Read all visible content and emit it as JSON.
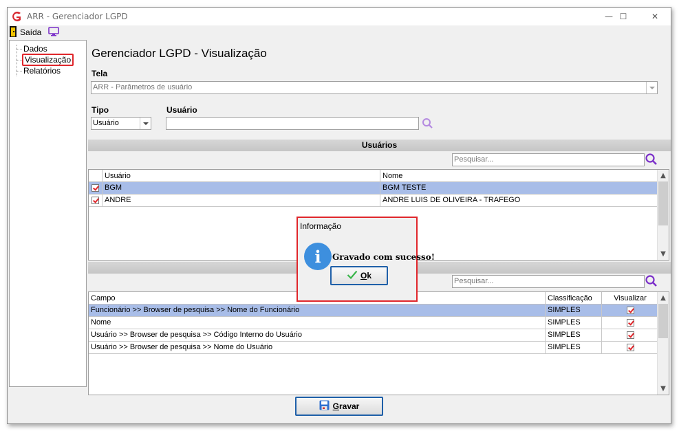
{
  "window": {
    "title": "ARR - Gerenciador LGPD",
    "minimize_glyph": "—",
    "maximize_glyph": "☐",
    "close_glyph": "✕"
  },
  "menubar": {
    "exit_label": "Saída"
  },
  "tree": {
    "items": [
      {
        "label": "Dados"
      },
      {
        "label": "Visualização"
      },
      {
        "label": "Relatórios"
      }
    ]
  },
  "page": {
    "title": "Gerenciador LGPD - Visualização",
    "screen_label": "Tela",
    "screen_value": "ARR - Parâmetros de usuário",
    "type_label": "Tipo",
    "type_value": "Usuário",
    "user_label": "Usuário",
    "user_value": ""
  },
  "users_section": {
    "title": "Usuários",
    "search_placeholder": "Pesquisar...",
    "columns": [
      "Usuário",
      "Nome"
    ],
    "rows": [
      {
        "checked": true,
        "user": "BGM",
        "name": "BGM TESTE"
      },
      {
        "checked": true,
        "user": "ANDRE",
        "name": "ANDRE LUIS DE OLIVEIRA - TRAFEGO"
      }
    ]
  },
  "fields_section": {
    "search_placeholder": "Pesquisar...",
    "columns": [
      "Campo",
      "Classificação",
      "Visualizar"
    ],
    "rows": [
      {
        "field": "Funcionário >> Browser de pesquisa >> Nome do Funcionário",
        "classification": "SIMPLES",
        "visualize": true
      },
      {
        "field": "Nome",
        "classification": "SIMPLES",
        "visualize": true
      },
      {
        "field": "Usuário >> Browser de pesquisa >> Código Interno do Usuário",
        "classification": "SIMPLES",
        "visualize": true
      },
      {
        "field": "Usuário >> Browser de pesquisa >> Nome do Usuário",
        "classification": "SIMPLES",
        "visualize": true
      }
    ]
  },
  "footer": {
    "save_letter": "G",
    "save_rest": "ravar"
  },
  "dialog": {
    "title": "Informação",
    "message": "Gravado com sucesso!",
    "ok_letter": "O",
    "ok_rest": "k"
  },
  "colors": {
    "selection_row": "#a8bde8",
    "highlight_border": "#e0262b",
    "info_icon": "#3d8fde",
    "search_icon": "#7b2fc9"
  }
}
